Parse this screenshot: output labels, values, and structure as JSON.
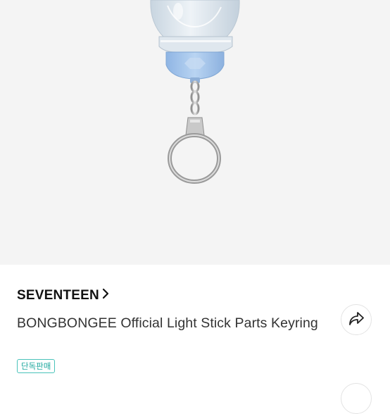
{
  "product": {
    "artist": "SEVENTEEN",
    "title": "BONGBONGEE Official Light Stick Parts Keyring",
    "badge": "단독판매"
  },
  "icons": {
    "artist_chevron": "chevron-right-icon",
    "share": "share-icon"
  },
  "colors": {
    "badge_accent": "#49c3ba",
    "image_background": "#f4f4f4",
    "light_stick_cap": "#a9c9ee"
  }
}
